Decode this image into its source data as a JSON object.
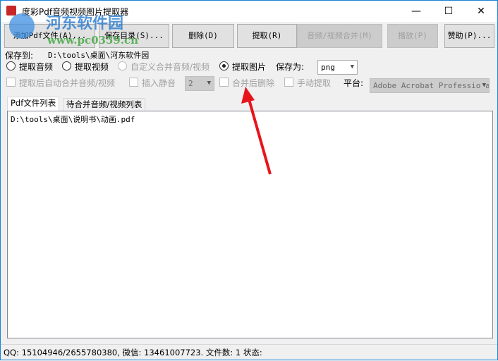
{
  "window": {
    "title": "度彩Pdf音频视频图片提取器",
    "minimize": "—",
    "maximize": "☐",
    "close": "✕"
  },
  "toolbar": {
    "add": "添加Pdf文件(A)...",
    "save_dir": "保存目录(S)...",
    "delete": "删除(D)",
    "extract": "提取(R)",
    "merge": "音频/视频合并(M)",
    "play": "播放(P)",
    "donate": "赞助(P)..."
  },
  "options": {
    "save_to_label": "保存到:",
    "save_to_path": "D:\\tools\\桌面\\河东软件园",
    "extract_audio": "提取音频",
    "extract_video": "提取视频",
    "custom_merge": "自定义合并音频/视频",
    "extract_image": "提取图片",
    "save_as_label": "保存为:",
    "save_as_value": "png",
    "auto_merge": "提取后自动合并音频/视频",
    "insert_silence": "插入静音",
    "silence_value": "2",
    "delete_after_merge": "合并后删除",
    "manual_extract": "手动提取",
    "platform_label": "平台:",
    "platform_value": "Adobe Acrobat Professional"
  },
  "tabs": [
    "Pdf文件列表",
    "待合并音频/视频列表"
  ],
  "files": [
    "D:\\tools\\桌面\\说明书\\动画.pdf"
  ],
  "status": "QQ: 15104946/2655780380, 微信: 13461007723. 文件数: 1  状态:",
  "watermark": {
    "name": "河东软件园",
    "url": "www.pc0359.cn"
  }
}
